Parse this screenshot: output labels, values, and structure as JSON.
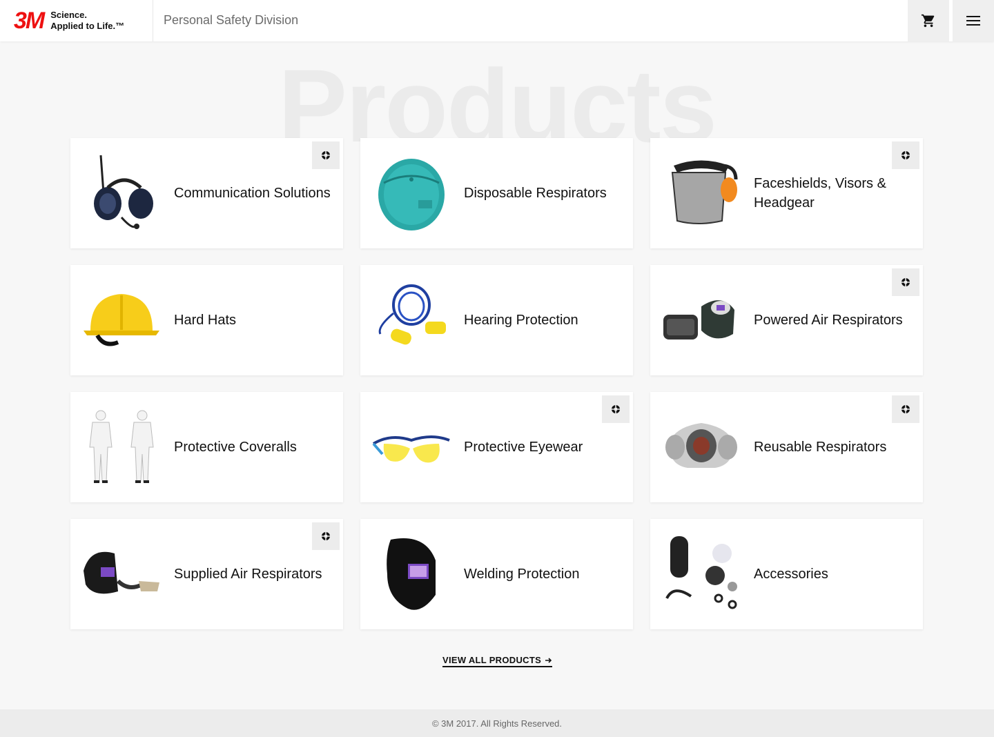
{
  "header": {
    "logo": "3M",
    "tagline_1": "Science.",
    "tagline_2": "Applied to Life.™",
    "division": "Personal Safety Division",
    "cart_icon": "cart-icon",
    "menu_icon": "hamburger-menu-icon"
  },
  "page": {
    "heading": "Products"
  },
  "products": [
    {
      "label": "Communication Solutions",
      "icon": "headset-icon",
      "badge": true
    },
    {
      "label": "Disposable Respirators",
      "icon": "disposable-mask-icon",
      "badge": false
    },
    {
      "label": "Faceshields, Visors & Headgear",
      "icon": "faceshield-icon",
      "badge": true
    },
    {
      "label": "Hard Hats",
      "icon": "hard-hat-icon",
      "badge": false
    },
    {
      "label": "Hearing Protection",
      "icon": "earplugs-icon",
      "badge": false
    },
    {
      "label": "Powered Air Respirators",
      "icon": "powered-respirator-icon",
      "badge": true
    },
    {
      "label": "Protective Coveralls",
      "icon": "coveralls-icon",
      "badge": false
    },
    {
      "label": "Protective Eyewear",
      "icon": "safety-glasses-icon",
      "badge": true
    },
    {
      "label": "Reusable Respirators",
      "icon": "reusable-respirator-icon",
      "badge": true
    },
    {
      "label": "Supplied Air Respirators",
      "icon": "supplied-air-icon",
      "badge": true
    },
    {
      "label": "Welding Protection",
      "icon": "welding-helmet-icon",
      "badge": false
    },
    {
      "label": "Accessories",
      "icon": "accessories-icon",
      "badge": false
    }
  ],
  "cta": {
    "view_all": "VIEW ALL PRODUCTS"
  },
  "footer": {
    "copyright": "© 3M 2017. All Rights Reserved."
  },
  "colors": {
    "brand_red": "#ee1111",
    "background": "#f7f7f7",
    "card": "#ffffff"
  }
}
